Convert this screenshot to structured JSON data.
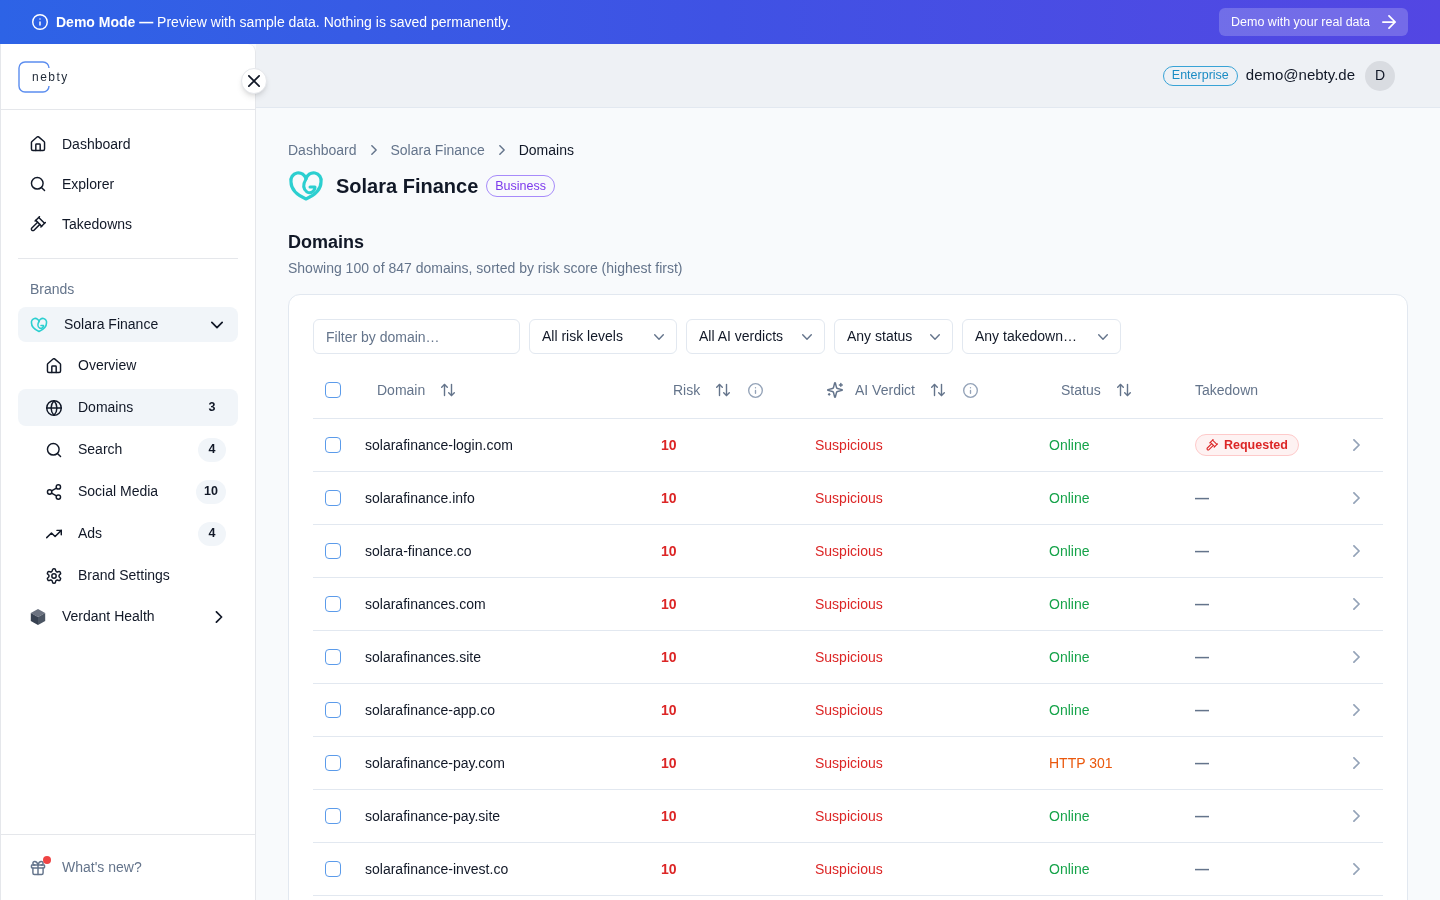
{
  "banner": {
    "message": "**Demo Mode —** Preview with sample data. Nothing is saved permanently.",
    "button": "Demo with your real data"
  },
  "sidebar": {
    "logo": "nebty",
    "nav": [
      {
        "label": "Dashboard",
        "selected": false
      },
      {
        "label": "Explorer",
        "selected": false
      },
      {
        "label": "Takedowns",
        "selected": false
      }
    ],
    "brands_heading": "Brands",
    "brands": [
      {
        "label": "Solara Finance",
        "selected": true,
        "expanded": true,
        "children": [
          {
            "label": "Overview",
            "selected": false
          },
          {
            "label": "Domains",
            "count": "3",
            "selected": true
          },
          {
            "label": "Search",
            "count": "4",
            "selected": false
          },
          {
            "label": "Social Media",
            "count": "10",
            "selected": false
          },
          {
            "label": "Ads",
            "count": "4",
            "selected": false
          },
          {
            "label": "Brand Settings",
            "selected": false
          }
        ]
      },
      {
        "label": "Verdant Health",
        "selected": false,
        "expanded": false
      }
    ],
    "footer": {
      "label": "What's new?",
      "unread": true
    }
  },
  "top_bar": {
    "plan": "Enterprise",
    "email": "demo@nebty.de",
    "avatar": "D"
  },
  "breadcrumbs": [
    {
      "label": "Dashboard",
      "current": false
    },
    {
      "label": "Solara Finance",
      "current": false
    },
    {
      "label": "Domains",
      "current": true
    }
  ],
  "brand": {
    "name": "Solara Finance",
    "tier": "Business"
  },
  "section": {
    "title": "Domains",
    "subtitle": "Showing 100 of 847 domains, sorted by risk score (highest first)"
  },
  "filters": {
    "search": {
      "placeholder": "Filter by domain…"
    },
    "selects": [
      "All risk levels",
      "All AI verdicts",
      "Any status",
      "Any takedown…"
    ]
  },
  "table": {
    "select_all": {
      "checked": false
    },
    "columns": [
      {
        "label": "Domain",
        "sortable": true,
        "info": false,
        "ai": false
      },
      {
        "label": "Risk",
        "sortable": true,
        "info": true,
        "ai": false
      },
      {
        "label": "AI Verdict",
        "sortable": true,
        "info": true,
        "ai": true
      },
      {
        "label": "Status",
        "sortable": true,
        "info": false,
        "ai": false
      },
      {
        "label": "Takedown",
        "sortable": false,
        "info": false,
        "ai": false
      }
    ],
    "rows": [
      {
        "checked": false,
        "domain": "solarafinance-login.com",
        "risk": "10",
        "verdict": "Suspicious",
        "status": {
          "text": "Online",
          "color": "#16a34a"
        },
        "takedown": {
          "kind": "badge",
          "text": "Requested"
        }
      },
      {
        "checked": false,
        "domain": "solarafinance.info",
        "risk": "10",
        "verdict": "Suspicious",
        "status": {
          "text": "Online",
          "color": "#16a34a"
        },
        "takedown": {
          "kind": "empty",
          "text": "—"
        }
      },
      {
        "checked": false,
        "domain": "solara-finance.co",
        "risk": "10",
        "verdict": "Suspicious",
        "status": {
          "text": "Online",
          "color": "#16a34a"
        },
        "takedown": {
          "kind": "empty",
          "text": "—"
        }
      },
      {
        "checked": false,
        "domain": "solarafinances.com",
        "risk": "10",
        "verdict": "Suspicious",
        "status": {
          "text": "Online",
          "color": "#16a34a"
        },
        "takedown": {
          "kind": "empty",
          "text": "—"
        }
      },
      {
        "checked": false,
        "domain": "solarafinances.site",
        "risk": "10",
        "verdict": "Suspicious",
        "status": {
          "text": "Online",
          "color": "#16a34a"
        },
        "takedown": {
          "kind": "empty",
          "text": "—"
        }
      },
      {
        "checked": false,
        "domain": "solarafinance-app.co",
        "risk": "10",
        "verdict": "Suspicious",
        "status": {
          "text": "Online",
          "color": "#16a34a"
        },
        "takedown": {
          "kind": "empty",
          "text": "—"
        }
      },
      {
        "checked": false,
        "domain": "solarafinance-pay.com",
        "risk": "10",
        "verdict": "Suspicious",
        "status": {
          "text": "HTTP 301",
          "color": "#ea580c"
        },
        "takedown": {
          "kind": "empty",
          "text": "—"
        }
      },
      {
        "checked": false,
        "domain": "solarafinance-pay.site",
        "risk": "10",
        "verdict": "Suspicious",
        "status": {
          "text": "Online",
          "color": "#16a34a"
        },
        "takedown": {
          "kind": "empty",
          "text": "—"
        }
      },
      {
        "checked": false,
        "domain": "solarafinance-invest.co",
        "risk": "10",
        "verdict": "Suspicious",
        "status": {
          "text": "Online",
          "color": "#16a34a"
        },
        "takedown": {
          "kind": "empty",
          "text": "—"
        }
      }
    ]
  }
}
